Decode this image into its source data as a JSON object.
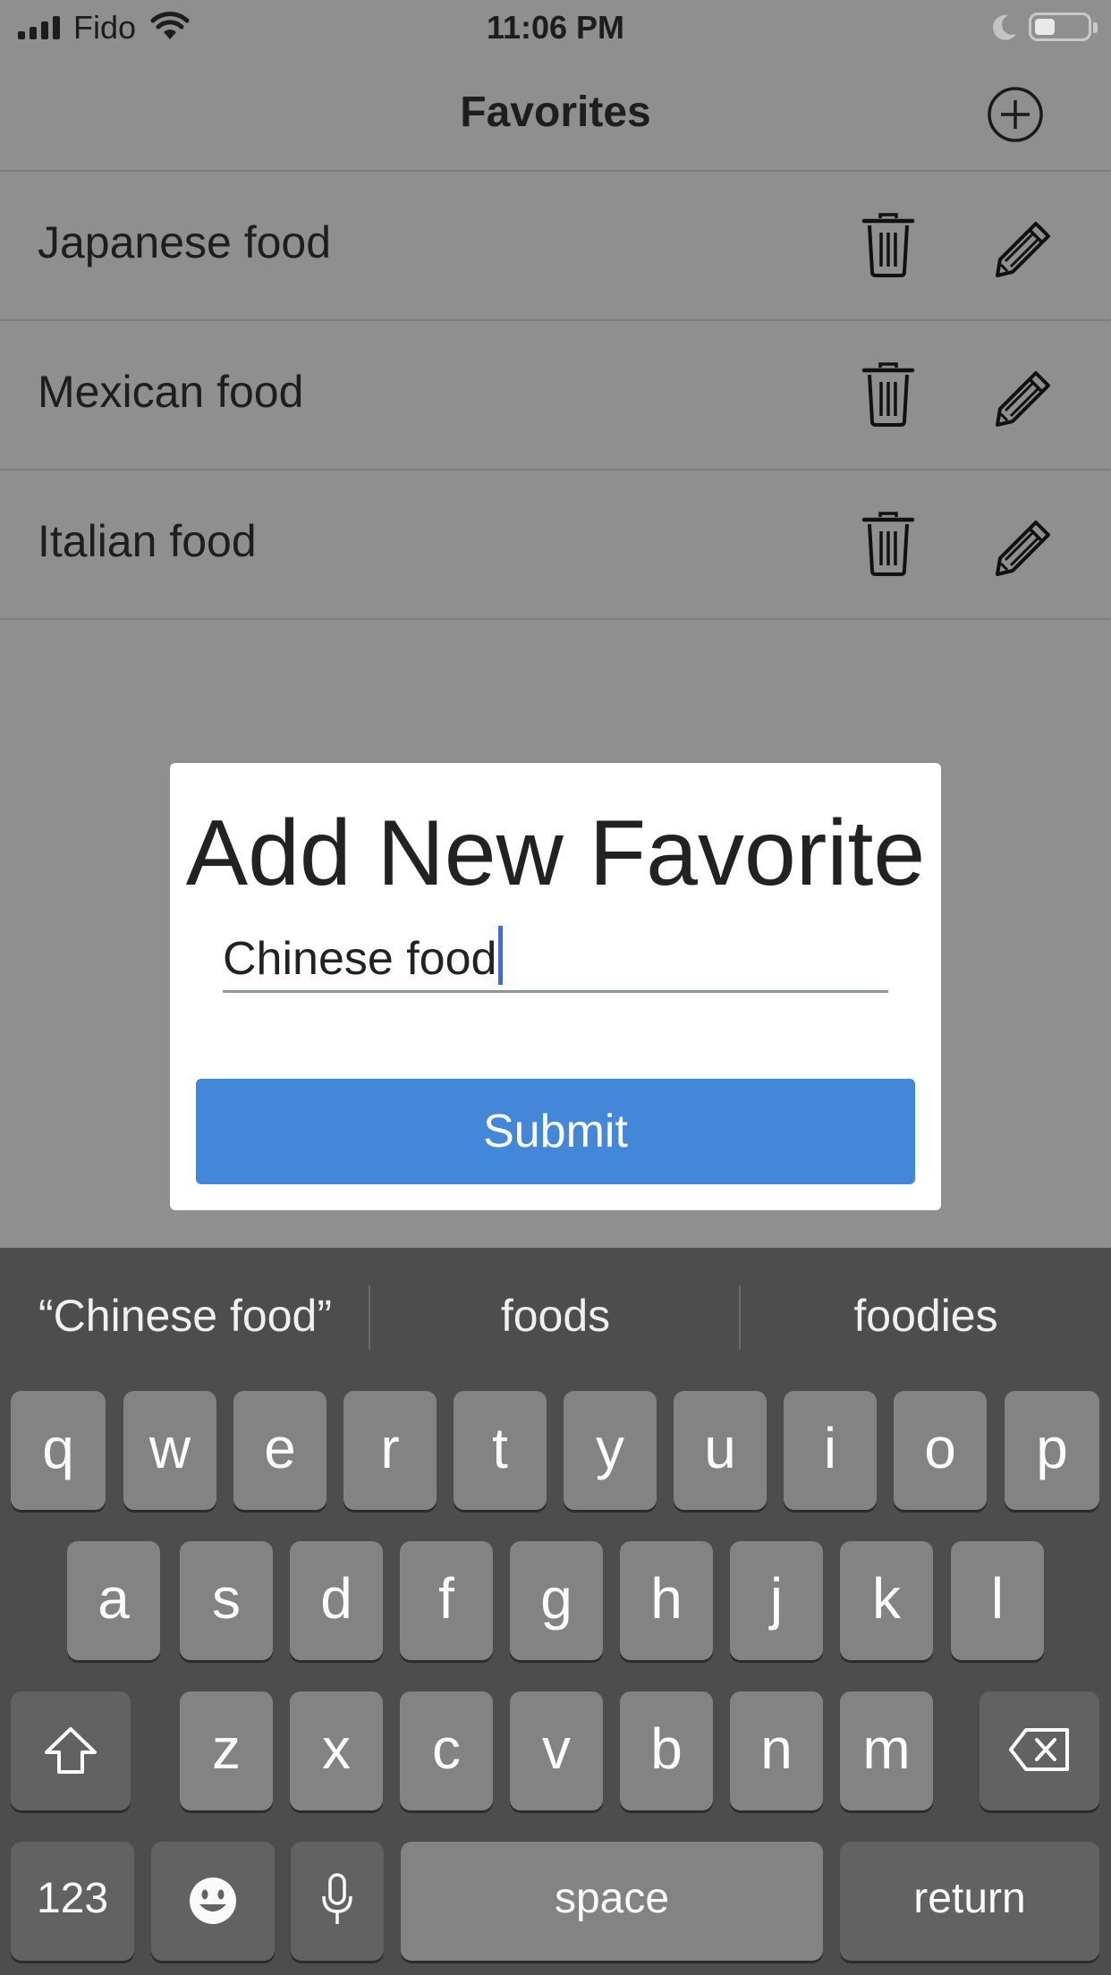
{
  "status_bar": {
    "carrier": "Fido",
    "time": "11:06 PM"
  },
  "nav": {
    "title": "Favorites",
    "add_icon": "plus-circle-icon"
  },
  "favorites": [
    {
      "label": "Japanese food"
    },
    {
      "label": "Mexican food"
    },
    {
      "label": "Italian food"
    }
  ],
  "modal": {
    "title": "Add New Favorite",
    "input_value": "Chinese food",
    "submit_label": "Submit"
  },
  "keyboard": {
    "suggestions": [
      "“Chinese food”",
      "foods",
      "foodies"
    ],
    "row1": [
      "q",
      "w",
      "e",
      "r",
      "t",
      "y",
      "u",
      "i",
      "o",
      "p"
    ],
    "row2": [
      "a",
      "s",
      "d",
      "f",
      "g",
      "h",
      "j",
      "k",
      "l"
    ],
    "row3": [
      "z",
      "x",
      "c",
      "v",
      "b",
      "n",
      "m"
    ],
    "numbers_label": "123",
    "space_label": "space",
    "return_label": "return"
  },
  "colors": {
    "accent": "#4387d8",
    "overlay": "#8f8f8f",
    "keyboard_bg": "#4d4d4d"
  }
}
